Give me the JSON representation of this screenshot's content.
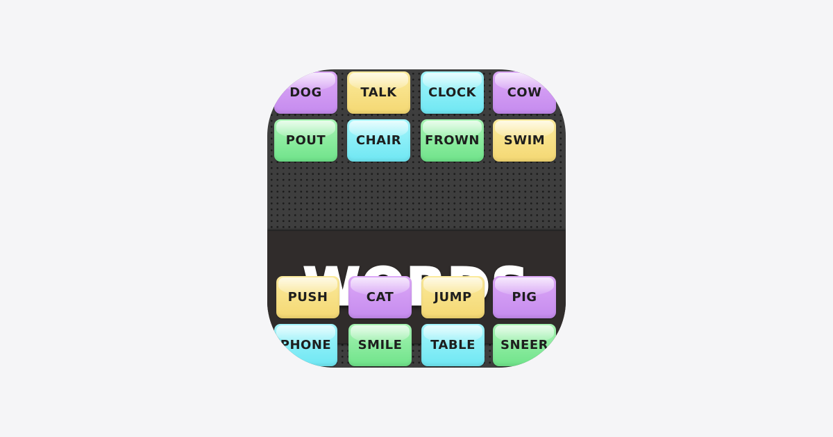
{
  "app": {
    "title": "WORDS",
    "colors": {
      "page_background": "#f5f5f7",
      "board": "#3e3e3e",
      "banner": "#302c2b",
      "purple": "#d29cf4",
      "yellow": "#f8e386",
      "cyan": "#8ceff8",
      "green": "#8decA0"
    }
  },
  "tiles": {
    "top_rows": [
      [
        {
          "word": "DOG",
          "color": "purple"
        },
        {
          "word": "TALK",
          "color": "yellow"
        },
        {
          "word": "CLOCK",
          "color": "cyan"
        },
        {
          "word": "COW",
          "color": "purple"
        }
      ],
      [
        {
          "word": "POUT",
          "color": "green"
        },
        {
          "word": "CHAIR",
          "color": "cyan"
        },
        {
          "word": "FROWN",
          "color": "green"
        },
        {
          "word": "SWIM",
          "color": "yellow"
        }
      ]
    ],
    "bottom_rows": [
      [
        {
          "word": "PUSH",
          "color": "yellow"
        },
        {
          "word": "CAT",
          "color": "purple"
        },
        {
          "word": "JUMP",
          "color": "yellow"
        },
        {
          "word": "PIG",
          "color": "purple"
        }
      ],
      [
        {
          "word": "PHONE",
          "color": "cyan"
        },
        {
          "word": "SMILE",
          "color": "green"
        },
        {
          "word": "TABLE",
          "color": "cyan"
        },
        {
          "word": "SNEER",
          "color": "green"
        }
      ]
    ]
  }
}
